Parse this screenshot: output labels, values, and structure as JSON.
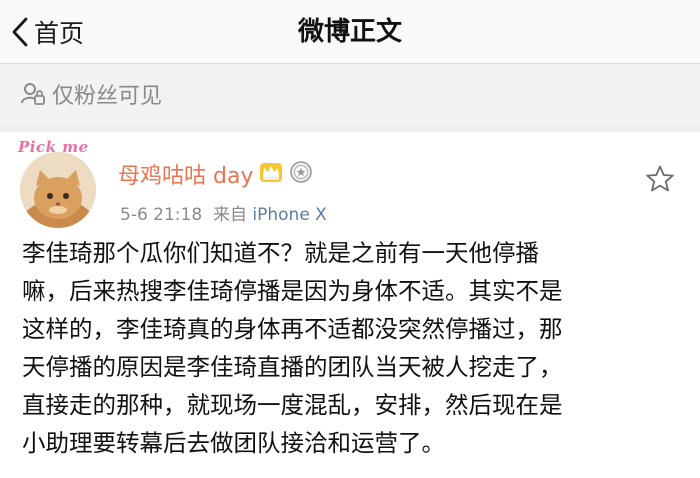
{
  "nav": {
    "back_label": "首页",
    "title": "微博正文"
  },
  "visibility": {
    "label": "仅粉丝可见"
  },
  "post": {
    "author": {
      "name": "母鸡咕咕 day",
      "avatar_text": "Pick me"
    },
    "time": "5-6 21:18",
    "source_prefix": "来自",
    "source_device": "iPhone X",
    "text_lines": [
      "李佳琦那个瓜你们知道不？就是之前有一天他停播",
      "嘛，后来热搜李佳琦停播是因为身体不适。其实不是",
      "这样的，李佳琦真的身体再不适都没突然停播过，那",
      "天停播的原因是李佳琦直播的团队当天被人挖走了，",
      "直接走的那种，就现场一度混乱，安排，然后现在是",
      "小助理要转幕后去做团队接洽和运营了。"
    ]
  },
  "icons": {
    "back": "chevron-left-icon",
    "visibility": "person-lock-icon",
    "crown": "crown-badge-icon",
    "medal": "medal-badge-icon",
    "favorite": "star-outline-icon"
  },
  "colors": {
    "author_name": "#eb7350",
    "source_device": "#5b7ba8",
    "meta": "#8a8a8a",
    "crown": "#f5b400"
  }
}
